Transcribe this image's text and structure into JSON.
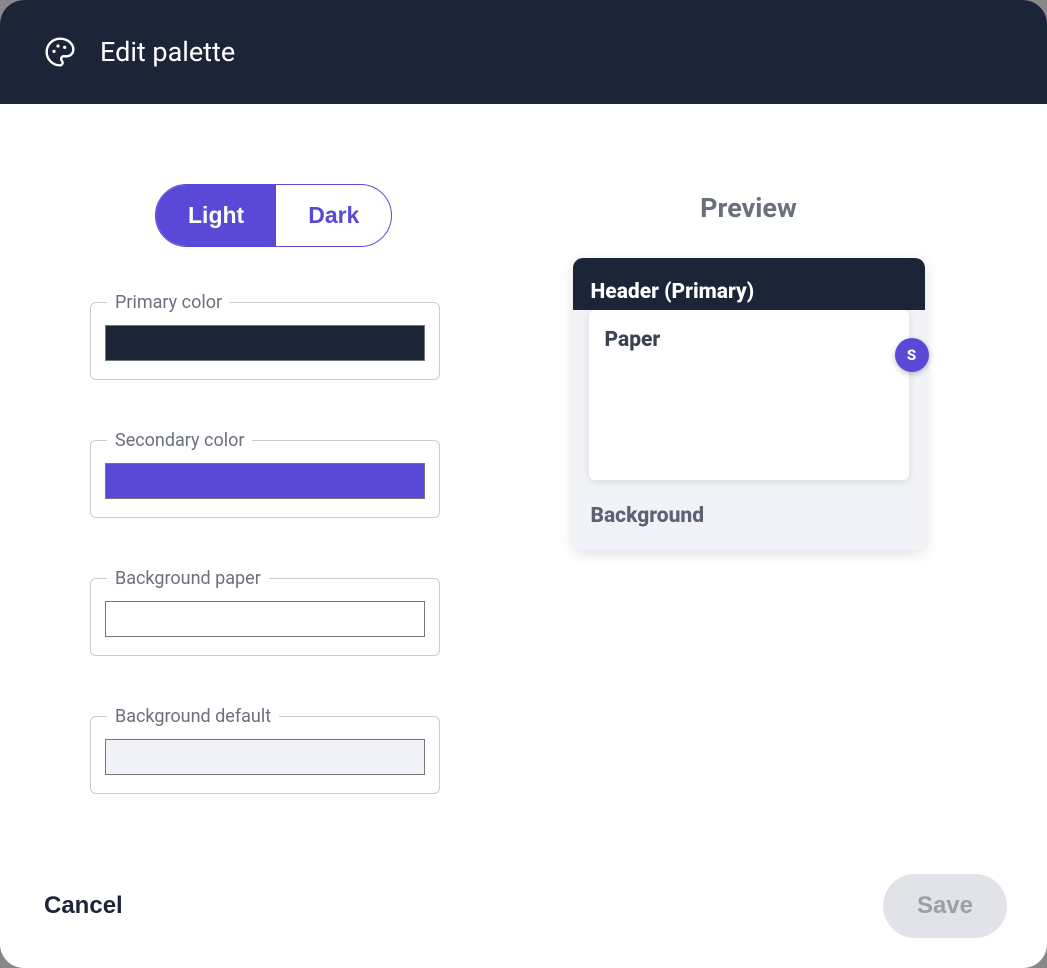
{
  "header": {
    "title": "Edit palette"
  },
  "mode": {
    "light_label": "Light",
    "dark_label": "Dark",
    "active": "light"
  },
  "fields": {
    "primary": {
      "label": "Primary color",
      "value": "#1b2537"
    },
    "secondary": {
      "label": "Secondary color",
      "value": "#5a49d6"
    },
    "bg_paper": {
      "label": "Background paper",
      "value": "#ffffff"
    },
    "bg_default": {
      "label": "Background default",
      "value": "#f1f3f8"
    }
  },
  "preview": {
    "title": "Preview",
    "header_label": "Header (Primary)",
    "paper_label": "Paper",
    "background_label": "Background",
    "fab_label": "S"
  },
  "footer": {
    "cancel_label": "Cancel",
    "save_label": "Save",
    "save_enabled": false
  }
}
